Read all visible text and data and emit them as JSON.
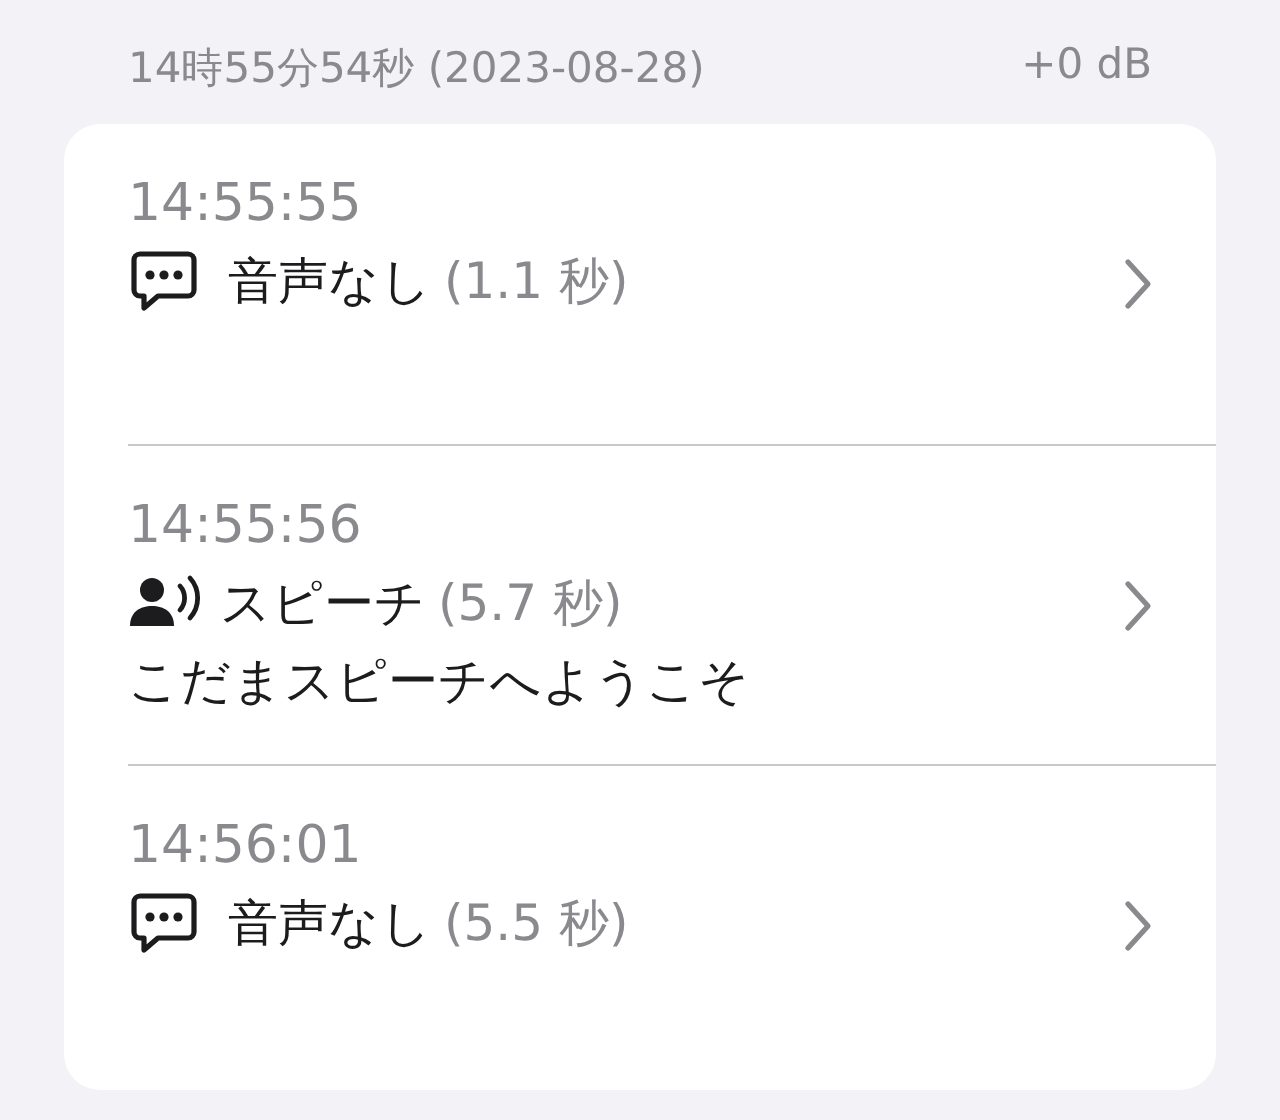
{
  "header": {
    "timestamp": "14時55分54秒 (2023-08-28)",
    "gain": "+0 dB"
  },
  "entries": [
    {
      "time": "14:55:55",
      "kind": "silence",
      "label": "音声なし",
      "duration": "(1.1 秒)"
    },
    {
      "time": "14:55:56",
      "kind": "speech",
      "label": "スピーチ",
      "duration": "(5.7 秒)",
      "transcript": "こだまスピーチへようこそ"
    },
    {
      "time": "14:56:01",
      "kind": "silence",
      "label": "音声なし",
      "duration": "(5.5 秒)"
    }
  ]
}
